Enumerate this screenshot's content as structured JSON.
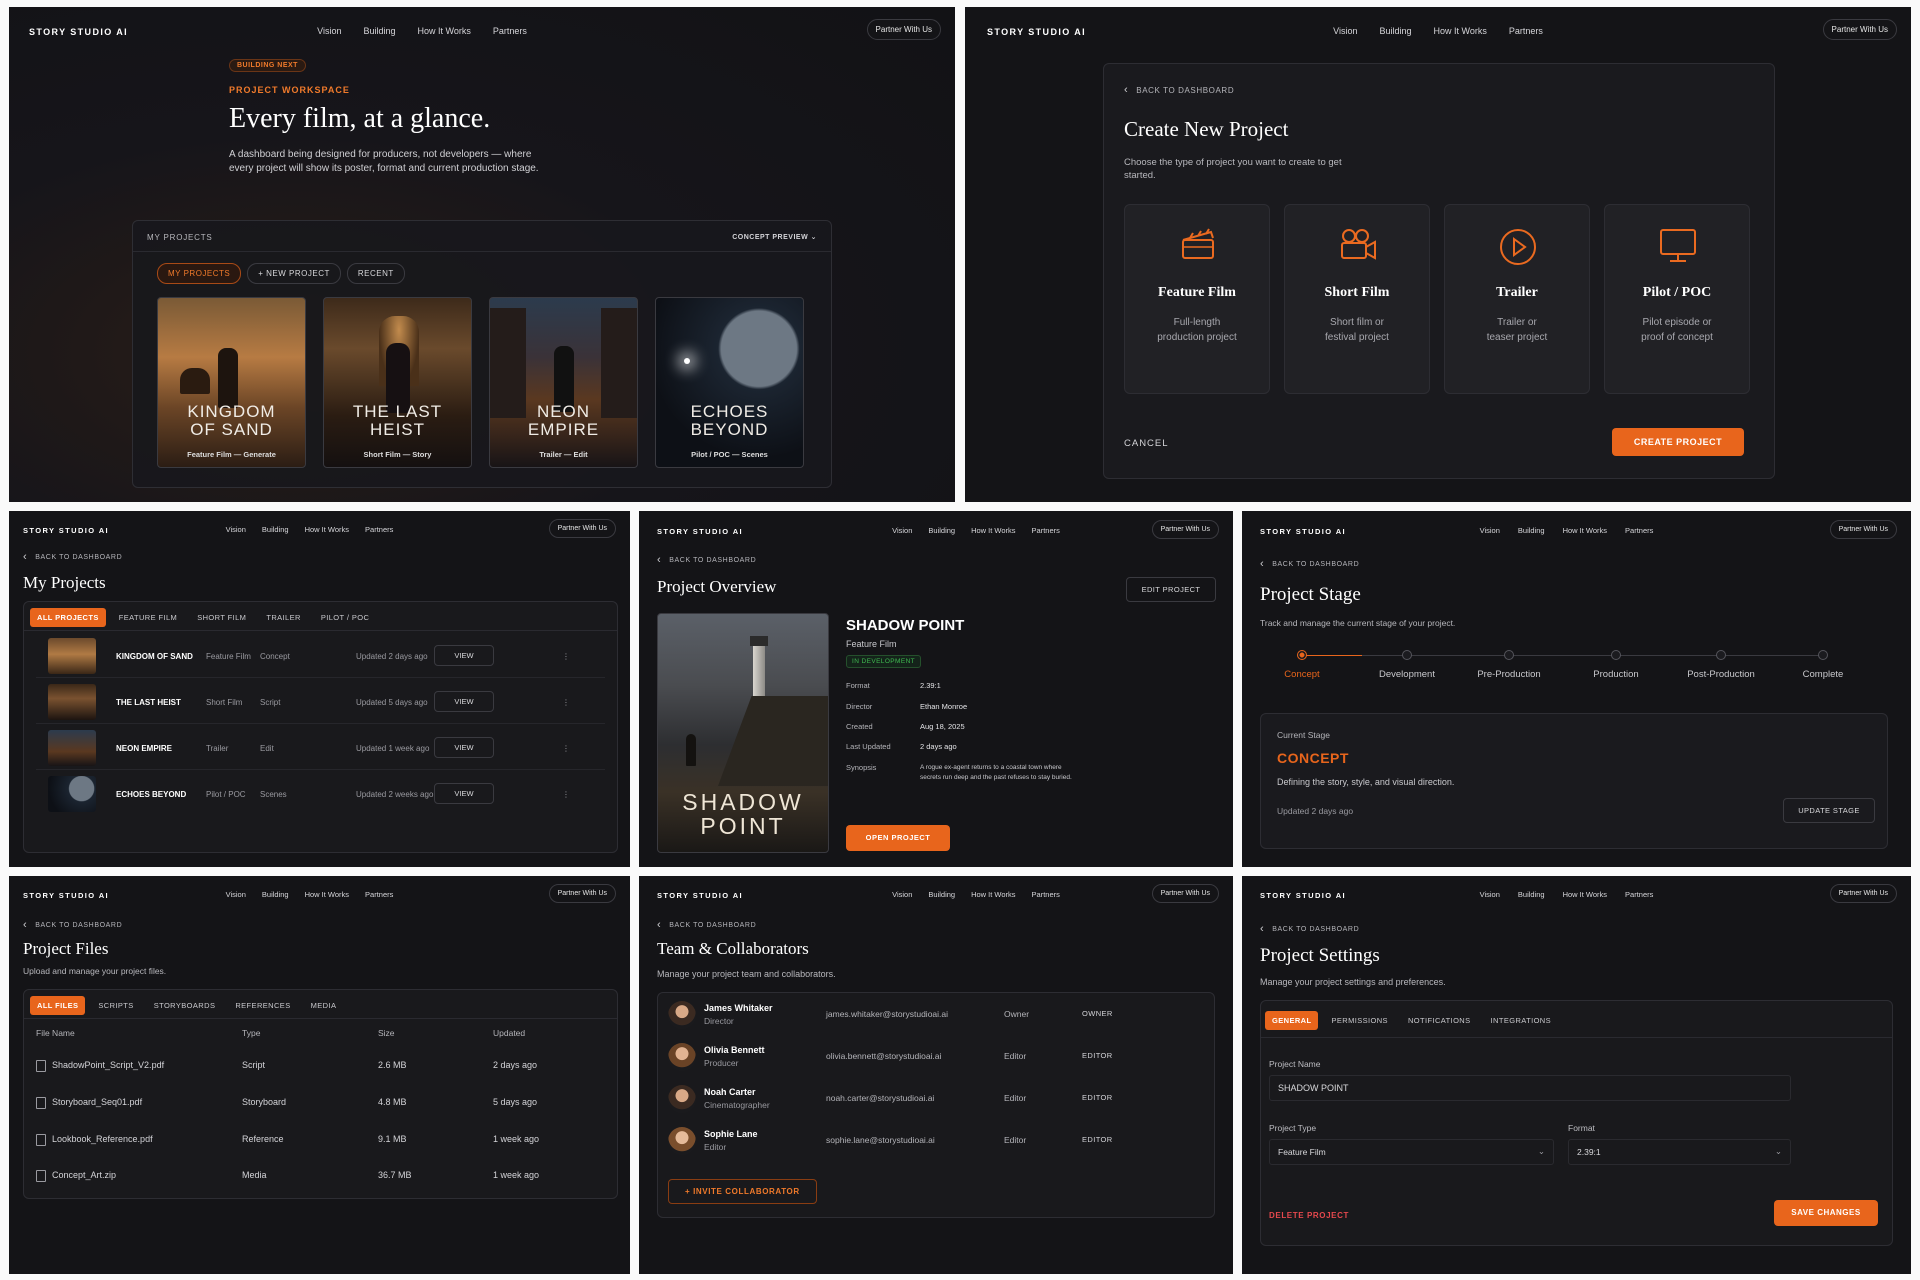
{
  "nav": {
    "brand": "STORY STUDIO AI",
    "links": [
      "Vision",
      "Building",
      "How It Works",
      "Partners"
    ],
    "partner": "Partner With Us"
  },
  "back": "BACK TO DASHBOARD",
  "hero": {
    "badge": "BUILDING NEXT",
    "eyebrow": "PROJECT WORKSPACE",
    "title": "Every film, at a glance.",
    "desc": "A dashboard being designed for producers, not developers — where every project will show its poster, format and current production stage.",
    "box_label": "MY PROJECTS",
    "preview": "CONCEPT PREVIEW",
    "tabs": [
      "MY PROJECTS",
      "+ NEW PROJECT",
      "RECENT"
    ],
    "posters": [
      {
        "title": "KINGDOM\nOF SAND",
        "sub": "Feature Film — Generate"
      },
      {
        "title": "THE LAST\nHEIST",
        "sub": "Short Film — Story"
      },
      {
        "title": "NEON\nEMPIRE",
        "sub": "Trailer — Edit"
      },
      {
        "title": "ECHOES\nBEYOND",
        "sub": "Pilot / POC — Scenes"
      }
    ]
  },
  "create": {
    "title": "Create New Project",
    "desc": "Choose the type of project you want to create to get started.",
    "types": [
      {
        "name": "Feature Film",
        "desc": "Full-length production project",
        "icon": "clapperboard-icon"
      },
      {
        "name": "Short Film",
        "desc": "Short film or festival project",
        "icon": "camera-icon"
      },
      {
        "name": "Trailer",
        "desc": "Trailer or teaser project",
        "icon": "play-icon"
      },
      {
        "name": "Pilot / POC",
        "desc": "Pilot episode or proof of concept",
        "icon": "monitor-icon"
      }
    ],
    "cancel": "CANCEL",
    "submit": "CREATE PROJECT"
  },
  "projects": {
    "title": "My Projects",
    "tabs": [
      "ALL PROJECTS",
      "FEATURE FILM",
      "SHORT FILM",
      "TRAILER",
      "PILOT / POC"
    ],
    "rows": [
      {
        "name": "KINGDOM OF SAND",
        "type": "Feature Film",
        "stage": "Concept",
        "updated": "Updated 2 days ago"
      },
      {
        "name": "THE LAST HEIST",
        "type": "Short Film",
        "stage": "Script",
        "updated": "Updated 5 days ago"
      },
      {
        "name": "NEON EMPIRE",
        "type": "Trailer",
        "stage": "Edit",
        "updated": "Updated 1 week ago"
      },
      {
        "name": "ECHOES BEYOND",
        "type": "Pilot / POC",
        "stage": "Scenes",
        "updated": "Updated 2 weeks ago"
      }
    ],
    "view": "VIEW"
  },
  "overview": {
    "title": "Project Overview",
    "edit": "EDIT PROJECT",
    "poster": "SHADOW\nPOINT",
    "name": "SHADOW POINT",
    "type": "Feature Film",
    "status": "IN DEVELOPMENT",
    "labels": [
      "Format",
      "Director",
      "Created",
      "Last Updated",
      "Synopsis"
    ],
    "values": [
      "2.39:1",
      "Ethan Monroe",
      "Aug 18, 2025",
      "2 days ago",
      "A rogue ex-agent returns to a coastal town where secrets run deep and the past refuses to stay buried."
    ],
    "open": "OPEN PROJECT"
  },
  "stage": {
    "title": "Project Stage",
    "desc": "Track and manage the current stage of your project.",
    "stages": [
      "Concept",
      "Development",
      "Pre-Production",
      "Production",
      "Post-Production",
      "Complete"
    ],
    "current_label": "Current Stage",
    "current": "CONCEPT",
    "current_desc": "Defining the story, style, and visual direction.",
    "updated": "Updated 2 days ago",
    "update_btn": "UPDATE STAGE"
  },
  "files": {
    "title": "Project Files",
    "desc": "Upload and manage your project files.",
    "tabs": [
      "ALL FILES",
      "SCRIPTS",
      "STORYBOARDS",
      "REFERENCES",
      "MEDIA"
    ],
    "headers": [
      "File Name",
      "Type",
      "Size",
      "Updated"
    ],
    "rows": [
      [
        "ShadowPoint_Script_V2.pdf",
        "Script",
        "2.6 MB",
        "2 days ago"
      ],
      [
        "Storyboard_Seq01.pdf",
        "Storyboard",
        "4.8 MB",
        "5 days ago"
      ],
      [
        "Lookbook_Reference.pdf",
        "Reference",
        "9.1 MB",
        "1 week ago"
      ],
      [
        "Concept_Art.zip",
        "Media",
        "36.7 MB",
        "1 week ago"
      ]
    ]
  },
  "team": {
    "title": "Team & Collaborators",
    "desc": "Manage your project team and collaborators.",
    "members": [
      {
        "name": "James Whitaker",
        "role": "Director",
        "email": "james.whitaker@storystudioai.ai",
        "perm": "Owner",
        "tag": "OWNER"
      },
      {
        "name": "Olivia Bennett",
        "role": "Producer",
        "email": "olivia.bennett@storystudioai.ai",
        "perm": "Editor",
        "tag": "EDITOR"
      },
      {
        "name": "Noah Carter",
        "role": "Cinematographer",
        "email": "noah.carter@storystudioai.ai",
        "perm": "Editor",
        "tag": "EDITOR"
      },
      {
        "name": "Sophie Lane",
        "role": "Editor",
        "email": "sophie.lane@storystudioai.ai",
        "perm": "Editor",
        "tag": "EDITOR"
      }
    ],
    "invite": "+ INVITE COLLABORATOR"
  },
  "settings": {
    "title": "Project Settings",
    "desc": "Manage your project settings and preferences.",
    "tabs": [
      "GENERAL",
      "PERMISSIONS",
      "NOTIFICATIONS",
      "INTEGRATIONS"
    ],
    "name_label": "Project Name",
    "name_value": "SHADOW POINT",
    "type_label": "Project Type",
    "type_value": "Feature Film",
    "format_label": "Format",
    "format_value": "2.39:1",
    "delete": "DELETE PROJECT",
    "save": "SAVE CHANGES"
  },
  "colors": {
    "accent": "#e8651c",
    "panel": "#141417",
    "green": "#3fb950"
  }
}
